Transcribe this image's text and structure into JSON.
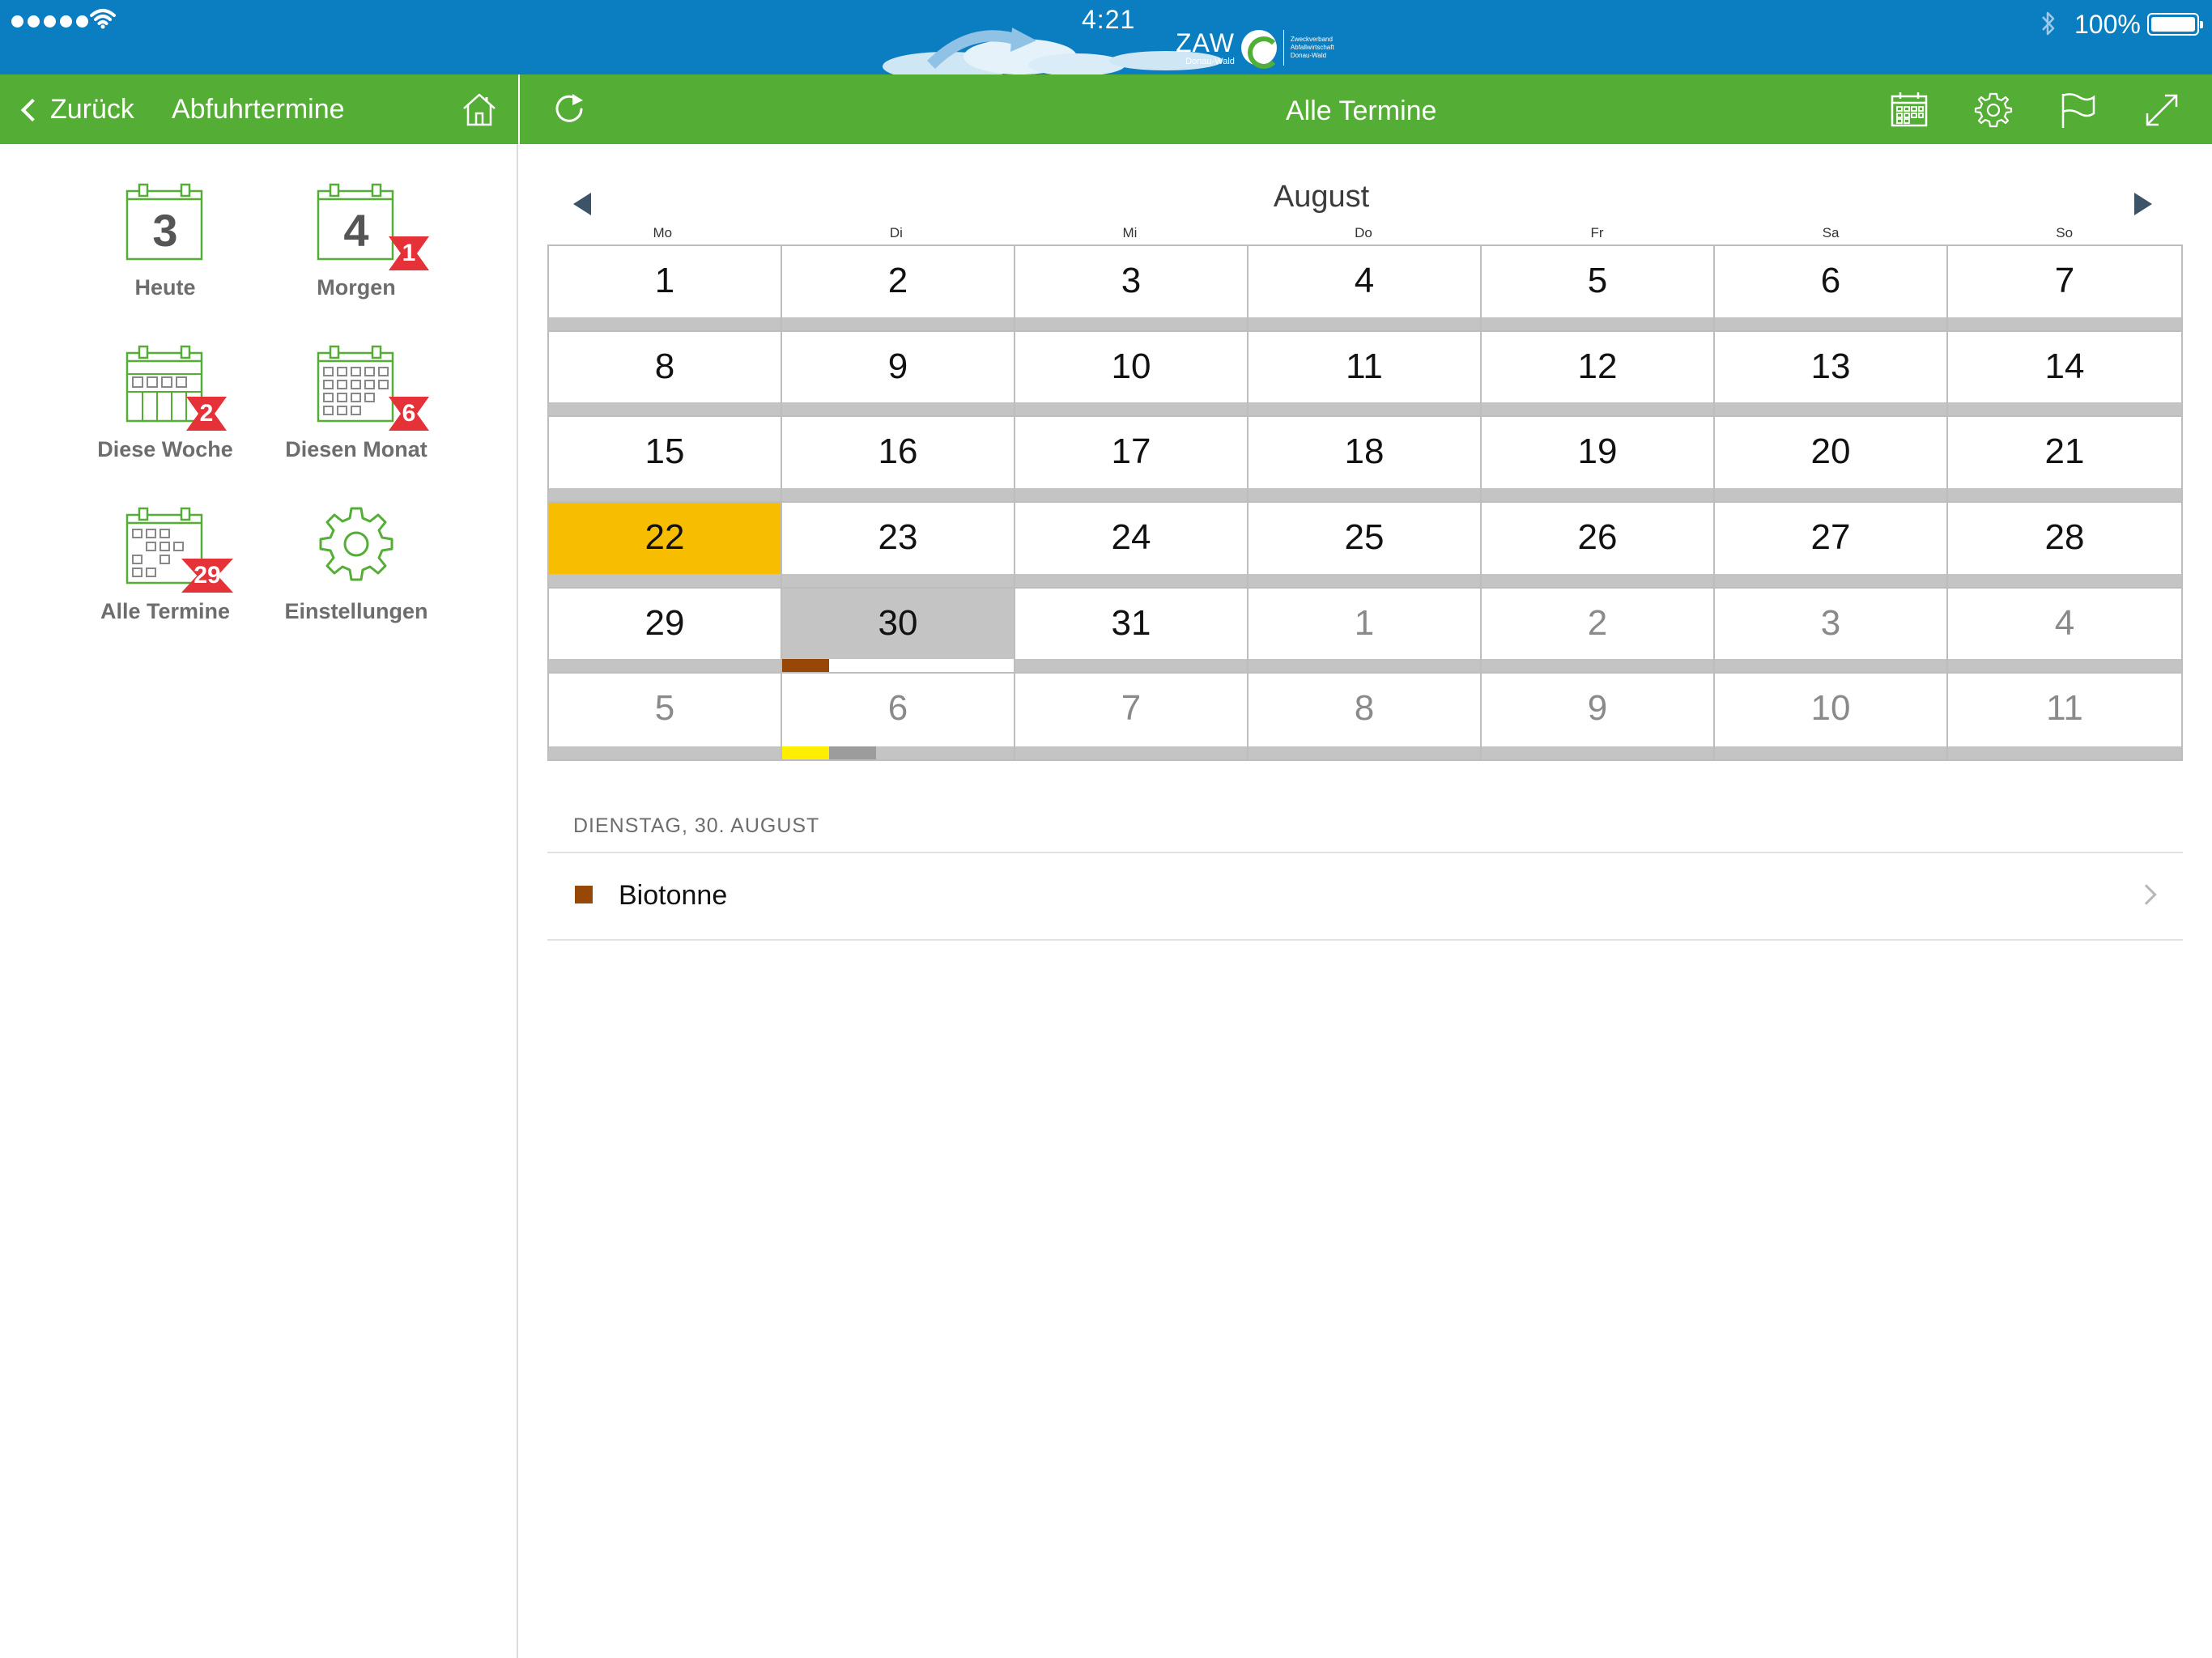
{
  "status_bar": {
    "time": "4:21",
    "battery_percent": "100%",
    "signal_bars": 5,
    "icons": [
      "wifi-icon",
      "bluetooth-icon",
      "battery-icon"
    ]
  },
  "logo": {
    "name": "ZAW",
    "subtitle": "Donau-Wald",
    "tagline": [
      "Zweckverband",
      "Abfallwirtschaft",
      "Donau-Wald"
    ]
  },
  "nav": {
    "back_label": "Zurück",
    "left_title": "Abfuhrtermine",
    "main_title": "Alle Termine",
    "icons": [
      "home-icon",
      "refresh-icon",
      "calendar-icon",
      "gear-icon",
      "flag-icon",
      "expand-icon"
    ]
  },
  "colors": {
    "status_bar": "#0b7ec1",
    "nav_bar": "#54ae36",
    "today": "#f7bd00",
    "selected": "#c4c4c4",
    "badge": "#e53238",
    "biotonne": "#974806",
    "yellow_bin": "#ffee00"
  },
  "sidebar": {
    "tiles": [
      {
        "label": "Heute",
        "icon_number": "3",
        "badge": ""
      },
      {
        "label": "Morgen",
        "icon_number": "4",
        "badge": "1"
      },
      {
        "label": "Diese Woche",
        "badge": "2"
      },
      {
        "label": "Diesen Monat",
        "badge": "6"
      },
      {
        "label": "Alle Termine",
        "badge": "29"
      },
      {
        "label": "Einstellungen",
        "badge": ""
      }
    ]
  },
  "calendar": {
    "month": "August",
    "weekdays": [
      "Mo",
      "Di",
      "Mi",
      "Do",
      "Fr",
      "Sa",
      "So"
    ],
    "weeks": [
      [
        {
          "d": "1"
        },
        {
          "d": "2"
        },
        {
          "d": "3"
        },
        {
          "d": "4"
        },
        {
          "d": "5"
        },
        {
          "d": "6"
        },
        {
          "d": "7"
        }
      ],
      [
        {
          "d": "8"
        },
        {
          "d": "9"
        },
        {
          "d": "10"
        },
        {
          "d": "11"
        },
        {
          "d": "12"
        },
        {
          "d": "13"
        },
        {
          "d": "14"
        }
      ],
      [
        {
          "d": "15"
        },
        {
          "d": "16"
        },
        {
          "d": "17"
        },
        {
          "d": "18"
        },
        {
          "d": "19"
        },
        {
          "d": "20"
        },
        {
          "d": "21"
        }
      ],
      [
        {
          "d": "22",
          "today": true
        },
        {
          "d": "23"
        },
        {
          "d": "24"
        },
        {
          "d": "25"
        },
        {
          "d": "26"
        },
        {
          "d": "27"
        },
        {
          "d": "28"
        }
      ],
      [
        {
          "d": "29"
        },
        {
          "d": "30",
          "selected": true,
          "marks": [
            "#974806"
          ]
        },
        {
          "d": "31"
        },
        {
          "d": "1",
          "other": true
        },
        {
          "d": "2",
          "other": true
        },
        {
          "d": "3",
          "other": true
        },
        {
          "d": "4",
          "other": true
        }
      ],
      [
        {
          "d": "5",
          "other": true
        },
        {
          "d": "6",
          "other": true,
          "marks": [
            "#ffee00",
            "#9c9c9c"
          ]
        },
        {
          "d": "7",
          "other": true
        },
        {
          "d": "8",
          "other": true
        },
        {
          "d": "9",
          "other": true
        },
        {
          "d": "10",
          "other": true
        },
        {
          "d": "11",
          "other": true
        }
      ]
    ]
  },
  "detail": {
    "section_header": "DIENSTAG, 30. AUGUST",
    "items": [
      {
        "label": "Biotonne",
        "color": "#974806"
      }
    ]
  }
}
